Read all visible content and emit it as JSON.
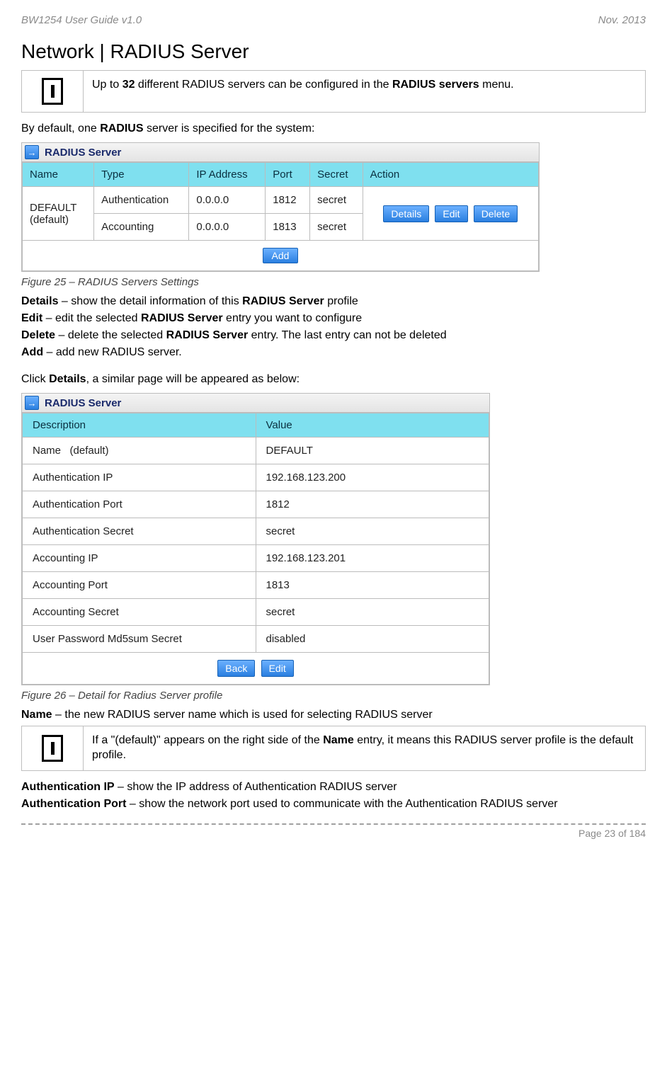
{
  "header": {
    "left": "BW1254 User Guide v1.0",
    "right": "Nov.  2013"
  },
  "title": "Network | RADIUS Server",
  "infobox1_pre": "Up to ",
  "infobox1_bold1": "32",
  "infobox1_mid": " different RADIUS servers can be configured in the ",
  "infobox1_bold2": "RADIUS servers",
  "infobox1_end": " menu.",
  "line1_pre": "By default, one ",
  "line1_bold": "RADIUS",
  "line1_post": " server is specified for the system:",
  "ui1": {
    "title": "RADIUS Server",
    "cols": [
      "Name",
      "Type",
      "IP Address",
      "Port",
      "Secret",
      "Action"
    ],
    "rowspan_name": "DEFAULT\n(default)",
    "rows": [
      {
        "type": "Authentication",
        "ip": "0.0.0.0",
        "port": "1812",
        "secret": "secret"
      },
      {
        "type": "Accounting",
        "ip": "0.0.0.0",
        "port": "1813",
        "secret": "secret"
      }
    ],
    "buttons": [
      "Details",
      "Edit",
      "Delete"
    ],
    "add": "Add"
  },
  "fig25": "Figure 25 – RADIUS Servers Settings",
  "defs": [
    {
      "term": "Details",
      "desc": " – show the detail information of this ",
      "bold": "RADIUS Server",
      "tail": " profile"
    },
    {
      "term": "Edit",
      "desc": " – edit the selected ",
      "bold": "RADIUS Server",
      "tail": " entry you want to configure"
    },
    {
      "term": "Delete",
      "desc": " – delete the selected ",
      "bold": "RADIUS Server",
      "tail": " entry. The last entry can not be deleted"
    },
    {
      "term": "Add",
      "desc": " – add new RADIUS server.",
      "bold": "",
      "tail": ""
    }
  ],
  "click_pre": "Click ",
  "click_bold": "Details",
  "click_post": ", a similar page will be appeared as below:",
  "ui2": {
    "title": "RADIUS Server",
    "head_desc": "Description",
    "head_val": "Value",
    "rows": [
      {
        "d": "Name   (default)",
        "v": "DEFAULT"
      },
      {
        "d": "Authentication IP",
        "v": "192.168.123.200"
      },
      {
        "d": "Authentication Port",
        "v": "1812"
      },
      {
        "d": "Authentication Secret",
        "v": "secret"
      },
      {
        "d": "Accounting IP",
        "v": "192.168.123.201"
      },
      {
        "d": "Accounting Port",
        "v": "1813"
      },
      {
        "d": "Accounting Secret",
        "v": "secret"
      },
      {
        "d": "User Password Md5sum Secret",
        "v": "disabled"
      }
    ],
    "buttons": [
      "Back",
      "Edit"
    ]
  },
  "fig26": "Figure 26 – Detail for Radius Server profile",
  "name_def_term": "Name",
  "name_def_rest": " – the new RADIUS server name which is used for selecting RADIUS server",
  "infobox2_pre": "If a \"(default)\" appears on the right side of the ",
  "infobox2_bold": "Name",
  "infobox2_post": " entry, it means this RADIUS server profile is the default profile.",
  "authip_term": "Authentication IP",
  "authip_rest": " – show the IP address of Authentication RADIUS server",
  "authport_term": "Authentication Port",
  "authport_rest": " – show the network port used to communicate with the Authentication RADIUS server",
  "footer": "Page 23 of 184"
}
